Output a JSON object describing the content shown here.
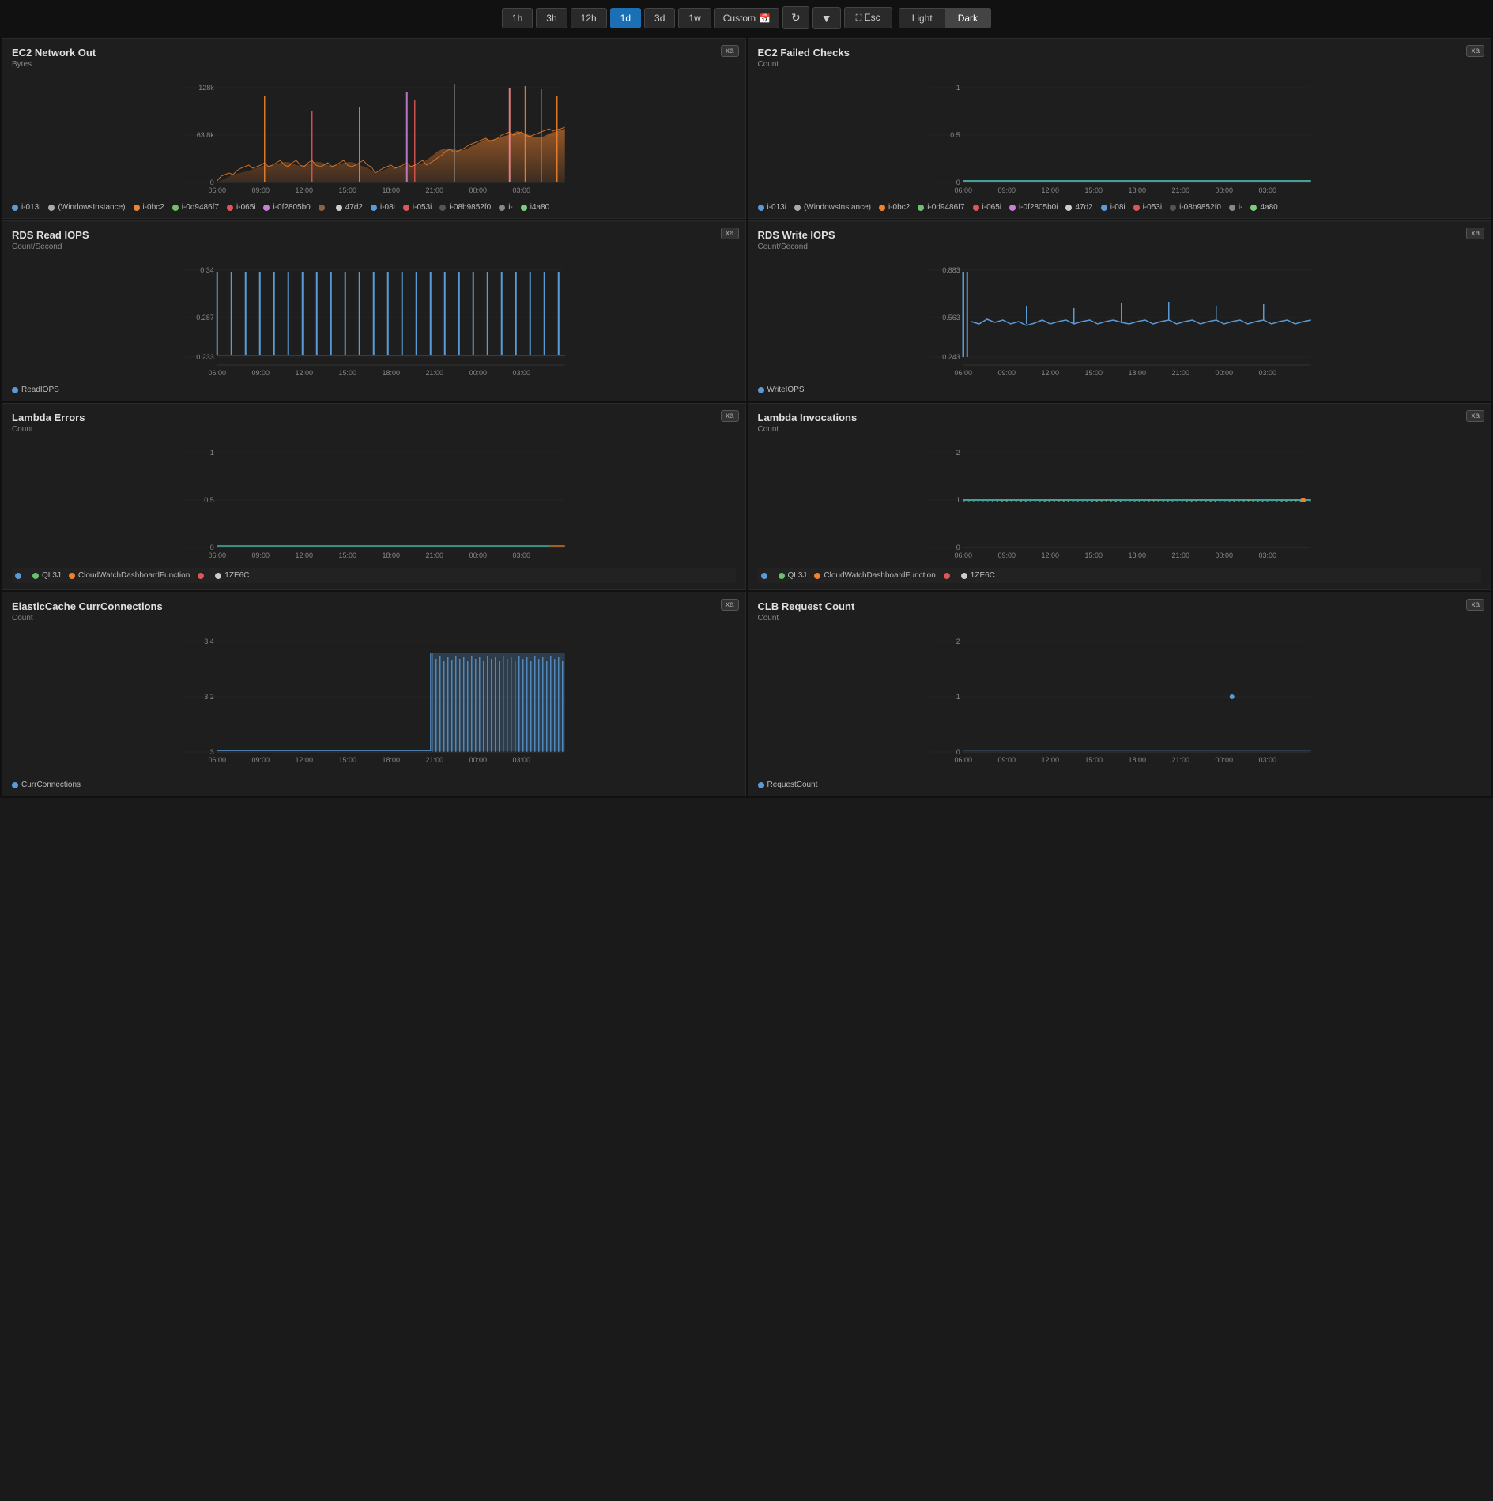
{
  "topbar": {
    "time_options": [
      "1h",
      "3h",
      "12h",
      "1d",
      "3d",
      "1w"
    ],
    "active_time": "1d",
    "custom_label": "Custom",
    "esc_label": "Esc",
    "light_label": "Light",
    "dark_label": "Dark",
    "active_theme": "Dark"
  },
  "panels": [
    {
      "id": "ec2-network-out",
      "title": "EC2 Network Out",
      "badge": "xa",
      "y_axis_label": "Bytes",
      "y_ticks": [
        "128k",
        "63.8k",
        "0"
      ],
      "x_ticks": [
        "06:00",
        "09:00",
        "12:00",
        "15:00",
        "18:00",
        "21:00",
        "00:00",
        "03:00"
      ],
      "type": "multiline_spiky",
      "legend": [
        {
          "color": "#5b9bd5",
          "label": "i-013i"
        },
        {
          "color": "#aaa",
          "label": "(WindowsInstance)"
        },
        {
          "color": "#f0822e",
          "label": "i-0bc2"
        },
        {
          "color": "#6dc16d",
          "label": "i-0d9486f7"
        },
        {
          "color": "#e05555",
          "label": "i-065i"
        },
        {
          "color": "#c97fd5",
          "label": "i-0f2805b0"
        },
        {
          "color": "#8a6246",
          "label": ""
        },
        {
          "color": "#ccc",
          "label": "47d2"
        },
        {
          "color": "#5b9bd5",
          "label": "i-08i"
        },
        {
          "color": "#e05555",
          "label": "i-053i"
        },
        {
          "color": "#555",
          "label": "i-08b9852f0"
        },
        {
          "color": "#888",
          "label": "i-"
        },
        {
          "color": "#7ecb7e",
          "label": "i4a80"
        }
      ]
    },
    {
      "id": "ec2-failed-checks",
      "title": "EC2 Failed Checks",
      "badge": "xa",
      "y_axis_label": "Count",
      "y_ticks": [
        "1",
        "0.5",
        "0"
      ],
      "x_ticks": [
        "06:00",
        "09:00",
        "12:00",
        "15:00",
        "18:00",
        "21:00",
        "00:00",
        "03:00"
      ],
      "type": "flatline",
      "legend": [
        {
          "color": "#5b9bd5",
          "label": "i-013i"
        },
        {
          "color": "#aaa",
          "label": "(WindowsInstance)"
        },
        {
          "color": "#f0822e",
          "label": "i-0bc2"
        },
        {
          "color": "#6dc16d",
          "label": "i-0d9486f7"
        },
        {
          "color": "#e05555",
          "label": "i-065i"
        },
        {
          "color": "#c97fd5",
          "label": "i-0f2805b0i"
        },
        {
          "color": "#8a6246",
          "label": ""
        },
        {
          "color": "#ccc",
          "label": "47d2"
        },
        {
          "color": "#5b9bd5",
          "label": "i-08i"
        },
        {
          "color": "#e05555",
          "label": "i-053i"
        },
        {
          "color": "#555",
          "label": "i-08b9852f0"
        },
        {
          "color": "#888",
          "label": "i-"
        },
        {
          "color": "#7ecb7e",
          "label": "4a80"
        }
      ]
    },
    {
      "id": "rds-read-iops",
      "title": "RDS Read IOPS",
      "badge": "xa",
      "y_axis_label": "Count/Second",
      "y_ticks": [
        "0.34",
        "0.287",
        "0.233"
      ],
      "x_ticks": [
        "06:00",
        "09:00",
        "12:00",
        "15:00",
        "18:00",
        "21:00",
        "00:00",
        "03:00"
      ],
      "type": "periodic_spikes",
      "legend": [
        {
          "color": "#5b9bd5",
          "label": "ReadIOPS"
        }
      ]
    },
    {
      "id": "rds-write-iops",
      "title": "RDS Write IOPS",
      "badge": "xa",
      "y_axis_label": "Count/Second",
      "y_ticks": [
        "0.883",
        "0.563",
        "0.243"
      ],
      "x_ticks": [
        "06:00",
        "09:00",
        "12:00",
        "15:00",
        "18:00",
        "21:00",
        "00:00",
        "03:00"
      ],
      "type": "write_iops",
      "legend": [
        {
          "color": "#5b9bd5",
          "label": "WriteIOPS"
        }
      ]
    },
    {
      "id": "lambda-errors",
      "title": "Lambda Errors",
      "badge": "xa",
      "y_axis_label": "Count",
      "y_ticks": [
        "1",
        "0.5",
        "0"
      ],
      "x_ticks": [
        "06:00",
        "09:00",
        "12:00",
        "15:00",
        "18:00",
        "21:00",
        "00:00",
        "03:00"
      ],
      "type": "near_zero",
      "legend": [
        {
          "color": "#5b9bd5",
          "label": ""
        },
        {
          "color": "#6dc16d",
          "label": "QL3J"
        },
        {
          "color": "#f0822e",
          "label": "CloudWatchDashboardFunction"
        },
        {
          "color": "#e05555",
          "label": ""
        },
        {
          "color": "#ccc",
          "label": "1ZE6C"
        }
      ]
    },
    {
      "id": "lambda-invocations",
      "title": "Lambda Invocations",
      "badge": "xa",
      "y_axis_label": "Count",
      "y_ticks": [
        "2",
        "1",
        "0"
      ],
      "x_ticks": [
        "06:00",
        "09:00",
        "12:00",
        "15:00",
        "18:00",
        "21:00",
        "00:00",
        "03:00"
      ],
      "type": "flat_one",
      "legend": [
        {
          "color": "#5b9bd5",
          "label": ""
        },
        {
          "color": "#6dc16d",
          "label": "QL3J"
        },
        {
          "color": "#f0822e",
          "label": "CloudWatchDashboardFunction"
        },
        {
          "color": "#e05555",
          "label": ""
        },
        {
          "color": "#ccc",
          "label": "1ZE6C"
        }
      ]
    },
    {
      "id": "elasticache-curr-connections",
      "title": "ElasticCache CurrConnections",
      "badge": "xa",
      "y_axis_label": "Count",
      "y_ticks": [
        "3.4",
        "3.2",
        "3"
      ],
      "x_ticks": [
        "06:00",
        "09:00",
        "12:00",
        "15:00",
        "18:00",
        "21:00",
        "00:00",
        "03:00"
      ],
      "type": "step_up",
      "legend": [
        {
          "color": "#5b9bd5",
          "label": "CurrConnections"
        }
      ]
    },
    {
      "id": "clb-request-count",
      "title": "CLB Request Count",
      "badge": "xa",
      "y_axis_label": "Count",
      "y_ticks": [
        "2",
        "1",
        "0"
      ],
      "x_ticks": [
        "06:00",
        "09:00",
        "12:00",
        "15:00",
        "18:00",
        "21:00",
        "00:00",
        "03:00"
      ],
      "type": "clb_count",
      "legend": [
        {
          "color": "#5b9bd5",
          "label": "RequestCount"
        }
      ]
    }
  ]
}
